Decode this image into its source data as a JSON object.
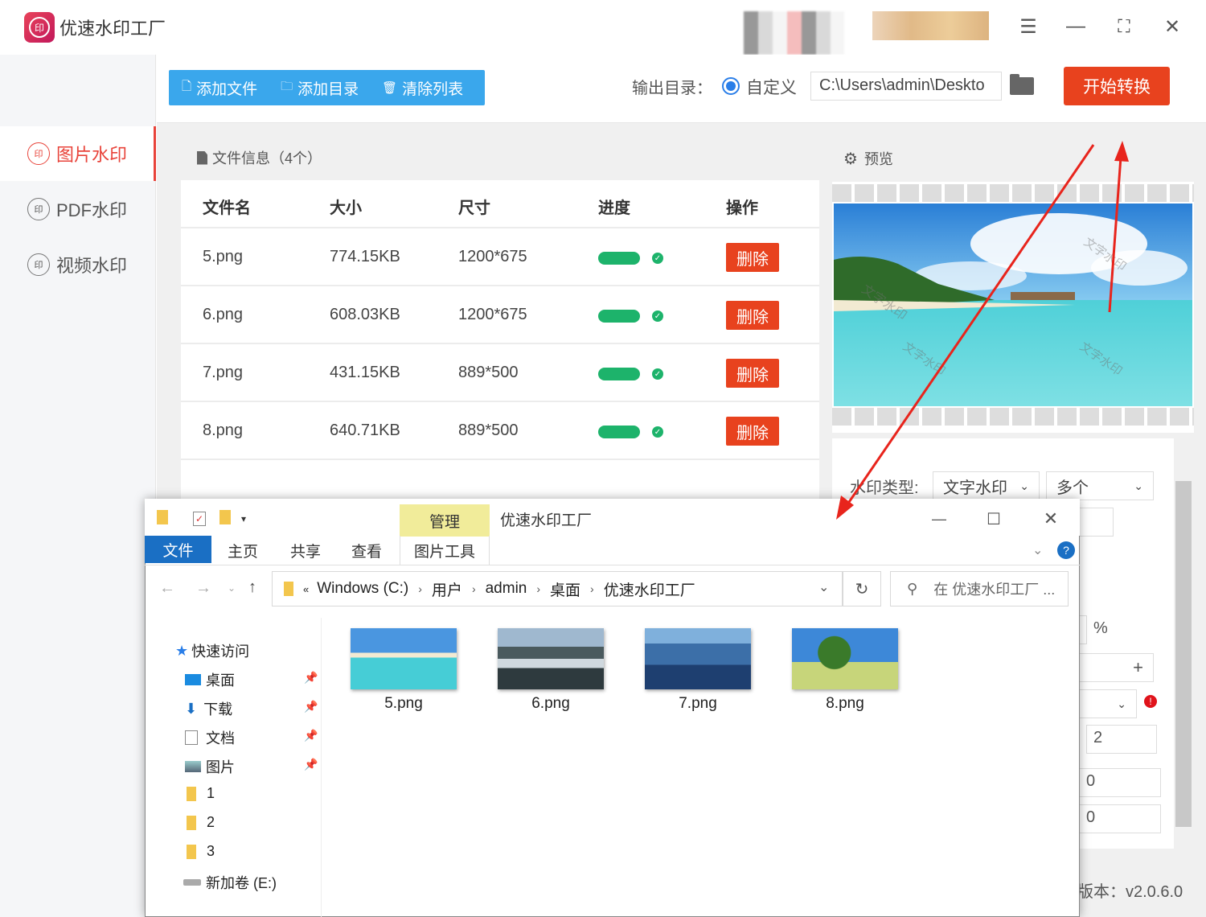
{
  "app": {
    "title": "优速水印工厂",
    "logo_text": "印",
    "version": "版本：v2.0.6.0"
  },
  "sidebar": {
    "items": [
      {
        "label": "图片水印",
        "active": true
      },
      {
        "label": "PDF水印",
        "active": false
      },
      {
        "label": "视频水印",
        "active": false
      }
    ]
  },
  "toolbar": {
    "add_file": "添加文件",
    "add_dir": "添加目录",
    "clear_list": "清除列表",
    "output_label": "输出目录：",
    "custom_label": "自定义",
    "output_path": "C:\\Users\\admin\\Deskto",
    "start_button": "开始转换"
  },
  "file_panel": {
    "header": "文件信息（4个）",
    "columns": [
      "文件名",
      "大小",
      "尺寸",
      "进度",
      "操作"
    ],
    "rows": [
      {
        "name": "5.png",
        "size": "774.15KB",
        "dims": "1200*675",
        "progress": 1.0,
        "action": "删除"
      },
      {
        "name": "6.png",
        "size": "608.03KB",
        "dims": "1200*675",
        "progress": 1.0,
        "action": "删除"
      },
      {
        "name": "7.png",
        "size": "431.15KB",
        "dims": "889*500",
        "progress": 1.0,
        "action": "删除"
      },
      {
        "name": "8.png",
        "size": "640.71KB",
        "dims": "889*500",
        "progress": 1.0,
        "action": "删除"
      }
    ]
  },
  "preview": {
    "header": "预览",
    "watermark_text": "文字水印"
  },
  "settings": {
    "type_label": "水印类型:",
    "type_value": "文字水印",
    "count_value": "多个",
    "percent_unit": "%",
    "num1": "2",
    "num2": "0",
    "num3": "0"
  },
  "explorer": {
    "title": "优速水印工厂",
    "manage_tab": "管理",
    "tabs": {
      "file": "文件",
      "home": "主页",
      "share": "共享",
      "view": "查看",
      "picture_tools": "图片工具"
    },
    "path": [
      "Windows (C:)",
      "用户",
      "admin",
      "桌面",
      "优速水印工厂"
    ],
    "search_placeholder": "在 优速水印工厂 ...",
    "nav": {
      "quick_access": "快速访问",
      "desktop": "桌面",
      "downloads": "下载",
      "documents": "文档",
      "pictures": "图片",
      "folder1": "1",
      "folder2": "2",
      "folder3": "3",
      "drive": "新加卷 (E:)"
    },
    "files": [
      "5.png",
      "6.png",
      "7.png",
      "8.png"
    ]
  },
  "colors": {
    "accent_red": "#e8421e",
    "toolbar_blue": "#3aa7ec",
    "progress_green": "#1db36b"
  }
}
